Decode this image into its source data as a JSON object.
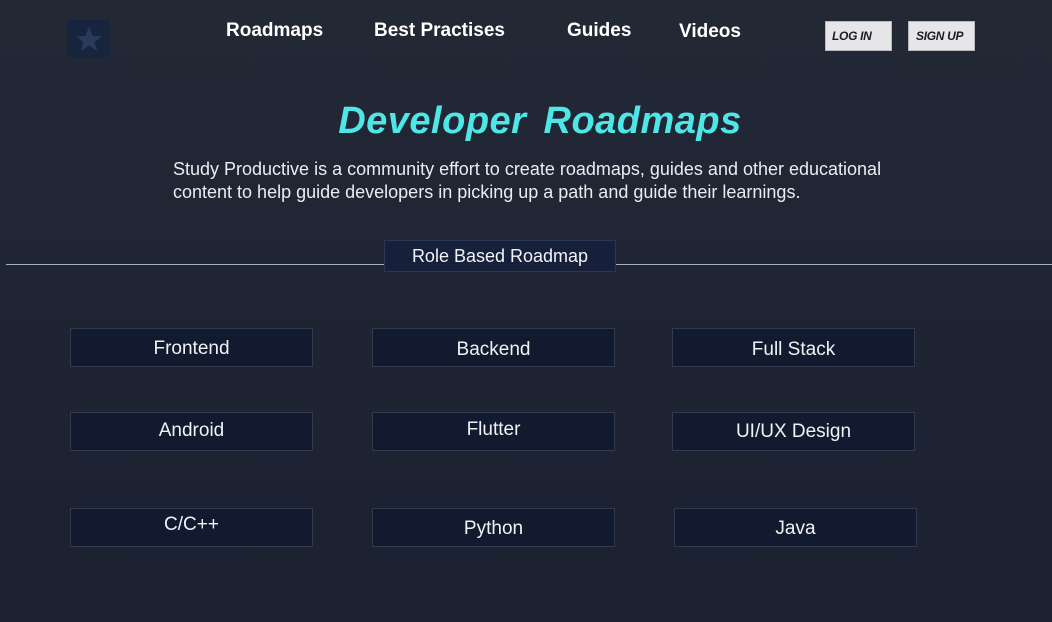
{
  "header": {
    "logo_icon": "star-icon",
    "nav": [
      {
        "label": "Roadmaps"
      },
      {
        "label": "Best Practises"
      },
      {
        "label": "Guides"
      },
      {
        "label": "Videos"
      }
    ],
    "login_label": "LOG IN",
    "signup_label": "SIGN UP"
  },
  "hero": {
    "title": "Developer Roadmaps",
    "description": "Study Productive is a community effort to create roadmaps, guides and other educational content to help guide developers in picking up a path and guide their learnings."
  },
  "section": {
    "label": "Role Based Roadmap"
  },
  "roles": [
    {
      "label": "Frontend"
    },
    {
      "label": "Backend"
    },
    {
      "label": "Full Stack"
    },
    {
      "label": "Android"
    },
    {
      "label": "Flutter"
    },
    {
      "label": "UI/UX Design"
    },
    {
      "label": "C/C++"
    },
    {
      "label": "Python"
    },
    {
      "label": "Java"
    }
  ],
  "colors": {
    "background": "#1e2430",
    "accent": "#4ee6e6",
    "button_bg": "#111a2e",
    "auth_button_bg": "#e6e6e8"
  }
}
